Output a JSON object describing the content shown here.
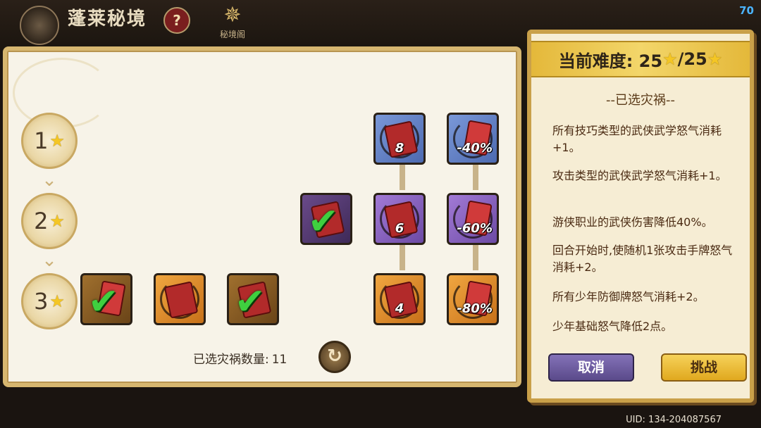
{
  "header": {
    "title": "蓬莱秘境",
    "help_icon": "?",
    "pavilion_label": "秘境阁",
    "fps": "70"
  },
  "tiers": [
    {
      "num": "1",
      "star": "★"
    },
    {
      "num": "2",
      "star": "★"
    },
    {
      "num": "3",
      "star": "★"
    }
  ],
  "cards": {
    "r1c1": {
      "value": "8",
      "color": "blue"
    },
    "r1c2": {
      "value": "-40%",
      "color": "blue"
    },
    "r2c0": {
      "value": "",
      "color": "dark-purple",
      "selected": true
    },
    "r2c1": {
      "value": "6",
      "color": "purple"
    },
    "r2c2": {
      "value": "-60%",
      "color": "purple"
    },
    "r3a": {
      "value": "",
      "color": "brown",
      "selected": true
    },
    "r3b": {
      "value": "",
      "color": "orange",
      "selected": false
    },
    "r3c": {
      "value": "",
      "color": "brown",
      "selected": true
    },
    "r3c1": {
      "value": "4",
      "color": "orange"
    },
    "r3c2": {
      "value": "-80%",
      "color": "orange"
    }
  },
  "footer": {
    "count_label": "已选灾祸数量:",
    "count_value": "11",
    "reset_icon": "↻"
  },
  "panel": {
    "difficulty_label": "当前难度: 25",
    "difficulty_total": "/25",
    "star": "★",
    "subtitle": "--已选灾祸--",
    "descriptions": [
      "所有技巧类型的武侠武学怒气消耗+1。",
      "攻击类型的武侠武学怒气消耗+1。",
      "游侠职业的武侠伤害降低40%。",
      "回合开始时,使随机1张攻击手牌怒气消耗+2。",
      "所有少年防御牌怒气消耗+2。",
      "少年基础怒气降低2点。"
    ],
    "cancel_label": "取消",
    "challenge_label": "挑战"
  },
  "uid": "UID: 134-204087567"
}
